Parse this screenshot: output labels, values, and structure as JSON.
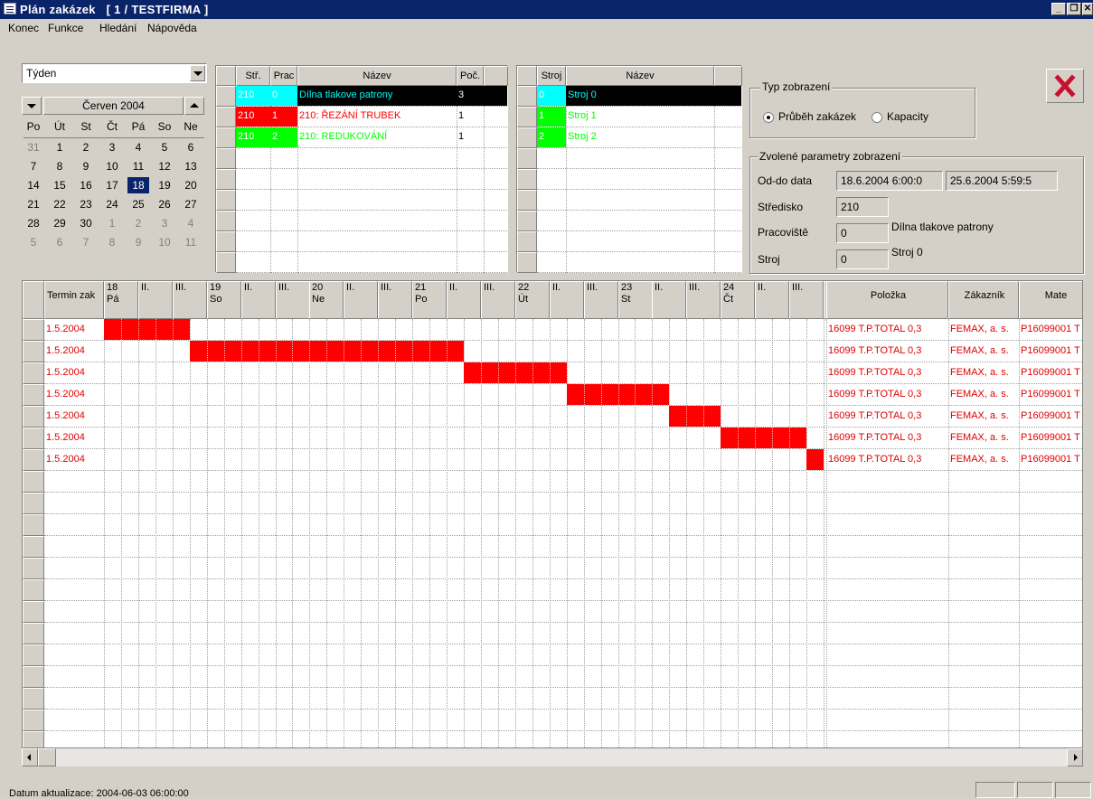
{
  "window": {
    "title": "Plán zakázek",
    "company": "[ 1 / TESTFIRMA ]",
    "buttons": [
      "_",
      "❐",
      "✕"
    ]
  },
  "menu": [
    "Konec",
    "Funkce",
    "Hledání",
    "Nápověda"
  ],
  "view_select": {
    "value": "Týden"
  },
  "calendar": {
    "month": "Červen 2004",
    "weekdays": [
      "Po",
      "Út",
      "St",
      "Čt",
      "Pá",
      "So",
      "Ne"
    ],
    "weeks": [
      [
        "31",
        "1",
        "2",
        "3",
        "4",
        "5",
        "6"
      ],
      [
        "7",
        "8",
        "9",
        "10",
        "11",
        "12",
        "13"
      ],
      [
        "14",
        "15",
        "16",
        "17",
        "18",
        "19",
        "20"
      ],
      [
        "21",
        "22",
        "23",
        "24",
        "25",
        "26",
        "27"
      ],
      [
        "28",
        "29",
        "30",
        "1",
        "2",
        "3",
        "4"
      ],
      [
        "5",
        "6",
        "7",
        "8",
        "9",
        "10",
        "11"
      ]
    ],
    "selected_day": "18"
  },
  "workplace_grid": {
    "headers": [
      "Stř.",
      "Prac",
      "Název",
      "Poč."
    ],
    "rows": [
      {
        "str": "210",
        "prac": "0",
        "nazev": "Dílna tlakove patrony",
        "poc": "3",
        "color": "#00ffff",
        "selected": true
      },
      {
        "str": "210",
        "prac": "1",
        "nazev": "210: ŘEZÁNÍ TRUBEK",
        "poc": "1",
        "color": "#ff0000",
        "selected": false
      },
      {
        "str": "210",
        "prac": "2",
        "nazev": "210: REDUKOVÁNÍ",
        "poc": "1",
        "color": "#00ff00",
        "selected": false
      }
    ]
  },
  "machine_grid": {
    "headers": [
      "Stroj",
      "Název"
    ],
    "rows": [
      {
        "stroj": "0",
        "nazev": "Stroj 0",
        "color": "#00ffff",
        "selected": true
      },
      {
        "stroj": "1",
        "nazev": "Stroj 1",
        "color": "#00ff00",
        "selected": false
      },
      {
        "stroj": "2",
        "nazev": "Stroj 2",
        "color": "#00ff00",
        "selected": false
      }
    ]
  },
  "display_type": {
    "label": "Typ zobrazení",
    "options": [
      "Průběh zakázek",
      "Kapacity"
    ],
    "selected": "Průběh zakázek"
  },
  "params": {
    "label": "Zvolené parametry zobrazení",
    "od_do_label": "Od-do data",
    "od": "18.6.2004 6:00:0",
    "do": "25.6.2004 5:59:5",
    "stredisko_label": "Středisko",
    "stredisko": "210",
    "pracoviste_label": "Pracoviště",
    "pracoviste": "0",
    "pracoviste_name": "Dílna tlakove patrony",
    "stroj_label": "Stroj",
    "stroj": "0",
    "stroj_name": "Stroj 0"
  },
  "gantt": {
    "first_col": "Termin zak",
    "days": [
      {
        "num": "18",
        "name": "Pá"
      },
      {
        "num": "19",
        "name": "So"
      },
      {
        "num": "20",
        "name": "Ne"
      },
      {
        "num": "21",
        "name": "Po"
      },
      {
        "num": "22",
        "name": "Út"
      },
      {
        "num": "23",
        "name": "St"
      },
      {
        "num": "24",
        "name": "Čt"
      }
    ],
    "shift_labels": [
      "II.",
      "III."
    ],
    "tail_cols": [
      "Položka",
      "Zákazník",
      "Mate"
    ],
    "rows": [
      {
        "termin": "1.5.2004",
        "polozka": "16099  T.P.TOTAL 0,3",
        "zakaznik": "FEMAX, a. s.",
        "mat": "P16099001 T",
        "bar_start": 0,
        "bar_len": 5
      },
      {
        "termin": "1.5.2004",
        "polozka": "16099  T.P.TOTAL 0,3",
        "zakaznik": "FEMAX, a. s.",
        "mat": "P16099001 T",
        "bar_start": 5,
        "bar_len": 16
      },
      {
        "termin": "1.5.2004",
        "polozka": "16099  T.P.TOTAL 0,3",
        "zakaznik": "FEMAX, a. s.",
        "mat": "P16099001 T",
        "bar_start": 21,
        "bar_len": 6
      },
      {
        "termin": "1.5.2004",
        "polozka": "16099  T.P.TOTAL 0,3",
        "zakaznik": "FEMAX, a. s.",
        "mat": "P16099001 T",
        "bar_start": 27,
        "bar_len": 6
      },
      {
        "termin": "1.5.2004",
        "polozka": "16099  T.P.TOTAL 0,3",
        "zakaznik": "FEMAX, a. s.",
        "mat": "P16099001 T",
        "bar_start": 33,
        "bar_len": 3
      },
      {
        "termin": "1.5.2004",
        "polozka": "16099  T.P.TOTAL 0,3",
        "zakaznik": "FEMAX, a. s.",
        "mat": "P16099001 T",
        "bar_start": 36,
        "bar_len": 5
      },
      {
        "termin": "1.5.2004",
        "polozka": "16099  T.P.TOTAL 0,3",
        "zakaznik": "FEMAX, a. s.",
        "mat": "P16099001 T",
        "bar_start": 41,
        "bar_len": 1
      }
    ],
    "bar_color": "#ff0000",
    "text_color": "#e00000"
  },
  "status": {
    "text": "Datum aktualizace: 2004-06-03 06:00:00"
  }
}
